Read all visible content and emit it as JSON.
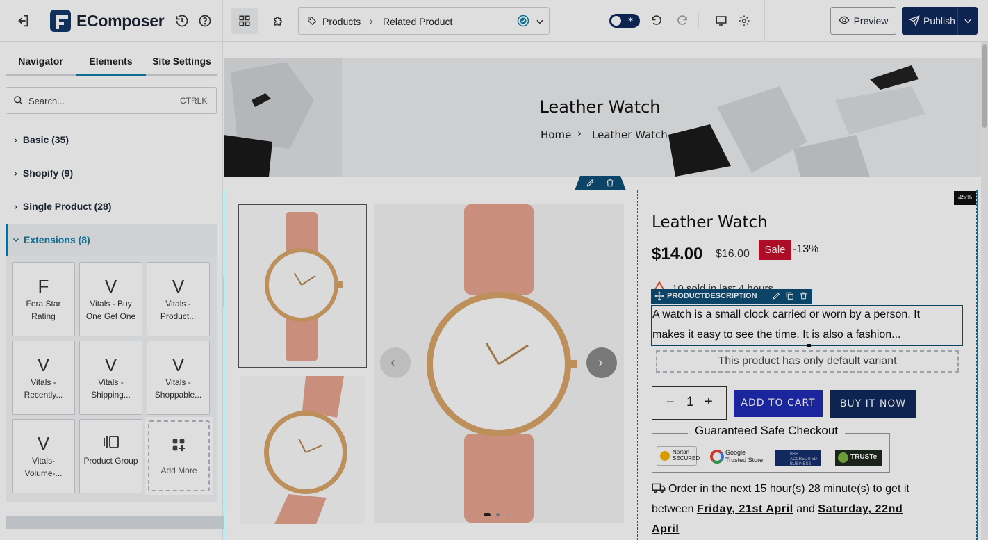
{
  "topbar": {
    "logo_text": "EComposer",
    "breadcrumb": {
      "root": "Products",
      "current": "Related Product"
    },
    "preview_label": "Preview",
    "publish_label": "Publish"
  },
  "sidebar": {
    "tabs": [
      {
        "label": "Navigator"
      },
      {
        "label": "Elements"
      },
      {
        "label": "Site Settings"
      }
    ],
    "search": {
      "placeholder": "Search...",
      "shortcut": "CTRLK"
    },
    "categories": [
      {
        "label": "Basic (35)"
      },
      {
        "label": "Shopify (9)"
      },
      {
        "label": "Single Product (28)"
      },
      {
        "label": "Extensions (8)"
      }
    ],
    "extensions": [
      {
        "glyph": "F",
        "label": "Fera Star Rating"
      },
      {
        "glyph": "V",
        "label": "Vitals - Buy One Get One"
      },
      {
        "glyph": "V",
        "label": "Vitals - Product..."
      },
      {
        "glyph": "V",
        "label": "Vitals - Recently..."
      },
      {
        "glyph": "V",
        "label": "Vitals - Shipping..."
      },
      {
        "glyph": "V",
        "label": "Vitals - Shoppable..."
      },
      {
        "glyph": "V",
        "label": "Vitals-Volume-..."
      },
      {
        "glyph": "",
        "label": "Product Group"
      },
      {
        "glyph": "",
        "label": "Add More"
      }
    ]
  },
  "banner": {
    "title": "Leather Watch",
    "crumb_home": "Home",
    "crumb_current": "Leather Watch"
  },
  "product": {
    "title": "Leather Watch",
    "price": "$14.00",
    "compare_price": "$16.00",
    "sale_badge": "Sale",
    "discount": "-13%",
    "sold_text": "10 sold in last 4 hours",
    "description_label": "PRODUCTDESCRIPTION",
    "description_line1": "A watch is a small clock carried or worn by a person. It",
    "description_line2": "makes it easy to see the time. It is also a fashion...",
    "variant_text": "This product has only default variant",
    "quantity": "1",
    "minus": "−",
    "plus": "+",
    "add_to_cart": "ADD TO CART",
    "buy_now": "BUY IT NOW",
    "checkout_title": "Guaranteed Safe Checkout",
    "badges": [
      "Norton SECURED",
      "Google Trusted Store",
      "BBB ACCREDITED BUSINESS",
      "TRUSTe"
    ],
    "order_line1": "Order in the next 15 hour(s) 28 minute(s) to get it",
    "order_between": "between",
    "date1": "Friday, 21st April",
    "order_and": "and",
    "date2": "Saturday, 22nd",
    "date2b": "April",
    "corner_badge": "45%"
  },
  "colors": {
    "accent": "#0f2a5c",
    "link": "#0e7fa8",
    "sale": "#c8102e",
    "cart": "#1f2bb6"
  }
}
